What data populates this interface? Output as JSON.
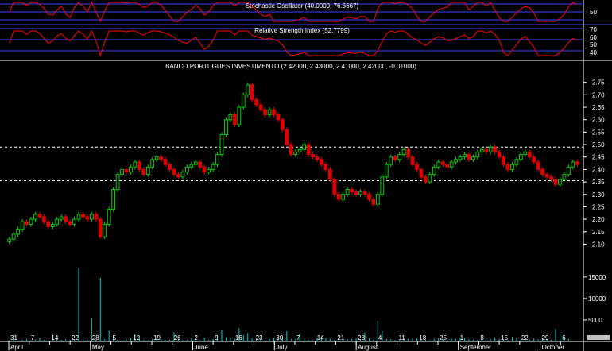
{
  "panels": {
    "stochastic": {
      "title": "Stochastic Oscillator (40.0000, 76.6667)",
      "ticks": [
        "50"
      ]
    },
    "rsi": {
      "title": "Relative Strength Index (52.7799)",
      "ticks": [
        "70",
        "60",
        "50",
        "40"
      ]
    },
    "price": {
      "title": "BANCO PORTUGUES INVESTIMENTO (2.42000, 2.43000, 2.41000, 2.42000, -0.01000)"
    },
    "volume": {
      "ticks": [
        "15000",
        "10000",
        "5000"
      ]
    }
  },
  "colors": {
    "up": "#00d000",
    "down": "#e00000",
    "osc_line": "#ff0000",
    "grid_blue": "#4040ff",
    "volume": "#00cccc",
    "background": "#000000"
  },
  "chart_data": {
    "type": "candlestick",
    "title": "BANCO PORTUGUES INVESTIMENTO (2.42000, 2.43000, 2.41000, 2.42000, -0.01000)",
    "y_ticks": [
      "2.75",
      "2.70",
      "2.65",
      "2.60",
      "2.55",
      "2.50",
      "2.45",
      "2.40",
      "2.35",
      "2.30",
      "2.25",
      "2.20",
      "2.15",
      "2.10"
    ],
    "ylim": [
      2.06,
      2.8
    ],
    "reference_lines": [
      2.49,
      2.355
    ],
    "x_tick_labels": [
      "31",
      "7",
      "14",
      "22",
      "28",
      "5",
      "12",
      "19",
      "26",
      "2",
      "9",
      "16",
      "23",
      "30",
      "7",
      "14",
      "21",
      "28",
      "4",
      "11",
      "18",
      "25",
      "1",
      "8",
      "15",
      "22",
      "29",
      "6"
    ],
    "x_month_labels": [
      "April",
      "May",
      "June",
      "July",
      "August",
      "September",
      "October"
    ],
    "closes": [
      2.12,
      2.14,
      2.16,
      2.19,
      2.18,
      2.2,
      2.22,
      2.21,
      2.19,
      2.17,
      2.18,
      2.2,
      2.21,
      2.19,
      2.18,
      2.2,
      2.22,
      2.21,
      2.2,
      2.22,
      2.2,
      2.13,
      2.18,
      2.24,
      2.32,
      2.38,
      2.4,
      2.39,
      2.41,
      2.43,
      2.4,
      2.38,
      2.41,
      2.44,
      2.45,
      2.44,
      2.42,
      2.4,
      2.38,
      2.37,
      2.39,
      2.41,
      2.42,
      2.43,
      2.41,
      2.39,
      2.4,
      2.42,
      2.46,
      2.54,
      2.6,
      2.62,
      2.58,
      2.65,
      2.7,
      2.74,
      2.68,
      2.66,
      2.64,
      2.62,
      2.64,
      2.62,
      2.6,
      2.56,
      2.5,
      2.46,
      2.47,
      2.48,
      2.5,
      2.46,
      2.45,
      2.44,
      2.42,
      2.4,
      2.36,
      2.3,
      2.28,
      2.3,
      2.32,
      2.31,
      2.3,
      2.31,
      2.3,
      2.28,
      2.26,
      2.3,
      2.37,
      2.42,
      2.45,
      2.44,
      2.46,
      2.48,
      2.45,
      2.42,
      2.4,
      2.37,
      2.35,
      2.38,
      2.41,
      2.43,
      2.42,
      2.41,
      2.43,
      2.44,
      2.45,
      2.46,
      2.44,
      2.45,
      2.47,
      2.48,
      2.47,
      2.49,
      2.47,
      2.45,
      2.42,
      2.4,
      2.42,
      2.44,
      2.46,
      2.47,
      2.45,
      2.43,
      2.4,
      2.38,
      2.37,
      2.36,
      2.34,
      2.36,
      2.38,
      2.41,
      2.43,
      2.42
    ],
    "volume": [
      300,
      800,
      200,
      400,
      600,
      300,
      500,
      900,
      400,
      300,
      1600,
      700,
      400,
      500,
      300,
      400,
      17000,
      600,
      300,
      5500,
      400,
      14800,
      500,
      2500,
      1200,
      400,
      300,
      600,
      800,
      1800,
      900,
      400,
      300,
      600,
      700,
      500,
      300,
      400,
      2100,
      500,
      300,
      400,
      700,
      500,
      300,
      900,
      400,
      600,
      1400,
      2600,
      1000,
      800,
      600,
      3100,
      1500,
      2000,
      700,
      500,
      900,
      400,
      600,
      800,
      700,
      900,
      2400,
      600,
      500,
      1700,
      700,
      400,
      300,
      900,
      1200,
      800,
      600,
      400,
      700,
      300,
      500,
      600,
      800,
      400,
      2100,
      700,
      400,
      4800,
      2400,
      600,
      500,
      300,
      400,
      800,
      600,
      900,
      700,
      500,
      400,
      300,
      600,
      800,
      500,
      400,
      700,
      600,
      900,
      800,
      500,
      400,
      300,
      600,
      700,
      500,
      900,
      600,
      400,
      300,
      1100,
      800,
      500,
      600,
      400,
      700,
      500,
      800,
      600,
      400,
      2900,
      1800,
      900,
      600
    ],
    "stochastic": {
      "name": "Stochastic Oscillator",
      "values": [
        40,
        76.6667
      ]
    },
    "rsi": {
      "name": "Relative Strength Index",
      "value": 52.7799
    }
  }
}
